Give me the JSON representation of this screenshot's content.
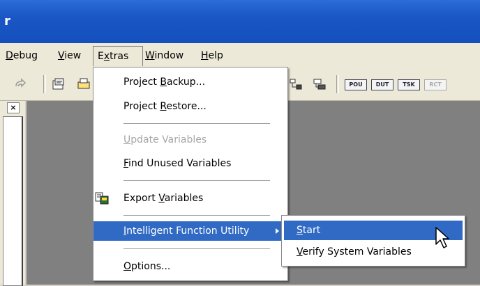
{
  "window": {
    "title_fragment": "r"
  },
  "menubar": {
    "items": [
      {
        "pre": "",
        "key": "D",
        "post": "ebug"
      },
      {
        "pre": "",
        "key": "V",
        "post": "iew"
      },
      {
        "pre": "E",
        "key": "x",
        "post": "tras"
      },
      {
        "pre": "",
        "key": "W",
        "post": "indow"
      },
      {
        "pre": "",
        "key": "H",
        "post": "elp"
      }
    ]
  },
  "toolbar": {
    "tags": [
      "POU",
      "DUT",
      "TSK",
      "RCT"
    ]
  },
  "panel": {
    "close_glyph": "×"
  },
  "extras_menu": {
    "items": [
      {
        "pre": "Project ",
        "key": "B",
        "post": "ackup..."
      },
      {
        "pre": "Project ",
        "key": "R",
        "post": "estore..."
      },
      {
        "pre": "",
        "key": "U",
        "post": "pdate Variables"
      },
      {
        "pre": "",
        "key": "F",
        "post": "ind Unused Variables"
      },
      {
        "pre": "Export ",
        "key": "V",
        "post": "ariables"
      },
      {
        "pre": "",
        "key": "I",
        "post": "ntelligent Function Utility"
      },
      {
        "pre": "",
        "key": "O",
        "post": "ptions..."
      }
    ]
  },
  "submenu": {
    "items": [
      {
        "pre": "",
        "key": "S",
        "post": "tart"
      },
      {
        "pre": "",
        "key": "V",
        "post": "erify System Variables"
      }
    ]
  },
  "colors": {
    "highlight": "#316ac5",
    "titlebar": "#1a56c4",
    "workspace": "#808080"
  }
}
